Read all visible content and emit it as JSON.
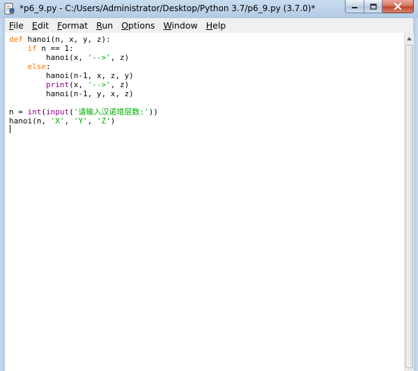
{
  "window": {
    "title": "*p6_9.py - C:/Users/Administrator/Desktop/Python 3.7/p6_9.py (3.7.0)*",
    "icon": "python-idle-icon",
    "controls": [
      "minimize-icon",
      "maximize-icon",
      "close-icon"
    ]
  },
  "menubar": {
    "items": [
      {
        "mnemonic": "F",
        "rest": "ile"
      },
      {
        "mnemonic": "E",
        "rest": "dit"
      },
      {
        "mnemonic": "F",
        "rest": "ormat"
      },
      {
        "mnemonic": "R",
        "rest": "un"
      },
      {
        "mnemonic": "O",
        "rest": "ptions"
      },
      {
        "mnemonic": "W",
        "rest": "indow"
      },
      {
        "mnemonic": "H",
        "rest": "elp"
      }
    ]
  },
  "editor": {
    "lines": [
      [
        {
          "t": "def",
          "c": "kw"
        },
        {
          "t": " hanoi(n, x, y, z):"
        }
      ],
      [
        {
          "t": "    "
        },
        {
          "t": "if",
          "c": "kw"
        },
        {
          "t": " n == 1:"
        }
      ],
      [
        {
          "t": "        hanoi(x, "
        },
        {
          "t": "'-->'",
          "c": "str"
        },
        {
          "t": ", z)"
        }
      ],
      [
        {
          "t": "    "
        },
        {
          "t": "else",
          "c": "kw"
        },
        {
          "t": ":"
        }
      ],
      [
        {
          "t": "        hanoi(n-1, x, z, y)"
        }
      ],
      [
        {
          "t": "        "
        },
        {
          "t": "print",
          "c": "bi"
        },
        {
          "t": "(x, "
        },
        {
          "t": "'-->'",
          "c": "str"
        },
        {
          "t": ", z)"
        }
      ],
      [
        {
          "t": "        hanoi(n-1, y, x, z)"
        }
      ],
      [
        {
          "t": ""
        }
      ],
      [
        {
          "t": "n = "
        },
        {
          "t": "int",
          "c": "bi"
        },
        {
          "t": "("
        },
        {
          "t": "input",
          "c": "bi"
        },
        {
          "t": "("
        },
        {
          "t": "'请输入汉诺塔层数:'",
          "c": "str"
        },
        {
          "t": "))"
        }
      ],
      [
        {
          "t": "hanoi(n, "
        },
        {
          "t": "'X'",
          "c": "str"
        },
        {
          "t": ", "
        },
        {
          "t": "'Y'",
          "c": "str"
        },
        {
          "t": ", "
        },
        {
          "t": "'Z'",
          "c": "str"
        },
        {
          "t": ")"
        }
      ],
      [
        {
          "t": ""
        }
      ]
    ]
  }
}
